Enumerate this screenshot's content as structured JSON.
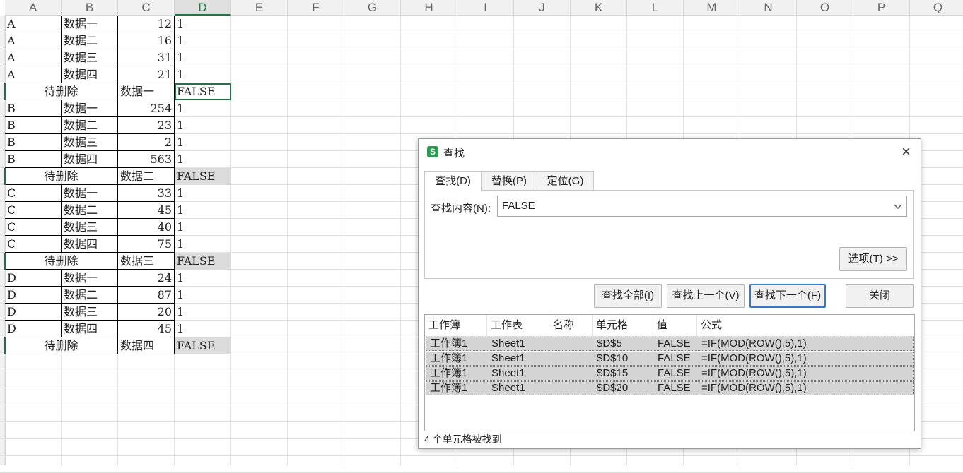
{
  "columns": [
    "A",
    "B",
    "C",
    "D",
    "E",
    "F",
    "G",
    "H",
    "I",
    "J",
    "K",
    "L",
    "M",
    "N",
    "O",
    "P",
    "Q"
  ],
  "rows": [
    {
      "a": "A",
      "b": "数据一",
      "c": "12",
      "d": "1"
    },
    {
      "a": "A",
      "b": "数据二",
      "c": "16",
      "d": "1"
    },
    {
      "a": "A",
      "b": "数据三",
      "c": "31",
      "d": "1"
    },
    {
      "a": "A",
      "b": "数据四",
      "c": "21",
      "d": "1"
    },
    {
      "merged": "待删除",
      "c": "数据一",
      "d": "FALSE"
    },
    {
      "a": "B",
      "b": "数据一",
      "c": "254",
      "d": "1"
    },
    {
      "a": "B",
      "b": "数据二",
      "c": "23",
      "d": "1"
    },
    {
      "a": "B",
      "b": "数据三",
      "c": "2",
      "d": "1"
    },
    {
      "a": "B",
      "b": "数据四",
      "c": "563",
      "d": "1"
    },
    {
      "merged": "待删除",
      "c": "数据二",
      "d": "FALSE"
    },
    {
      "a": "C",
      "b": "数据一",
      "c": "33",
      "d": "1"
    },
    {
      "a": "C",
      "b": "数据二",
      "c": "45",
      "d": "1"
    },
    {
      "a": "C",
      "b": "数据三",
      "c": "40",
      "d": "1"
    },
    {
      "a": "C",
      "b": "数据四",
      "c": "75",
      "d": "1"
    },
    {
      "merged": "待删除",
      "c": "数据三",
      "d": "FALSE"
    },
    {
      "a": "D",
      "b": "数据一",
      "c": "24",
      "d": "1"
    },
    {
      "a": "D",
      "b": "数据二",
      "c": "87",
      "d": "1"
    },
    {
      "a": "D",
      "b": "数据三",
      "c": "20",
      "d": "1"
    },
    {
      "a": "D",
      "b": "数据四",
      "c": "45",
      "d": "1"
    },
    {
      "merged": "待删除",
      "c": "数据四",
      "d": "FALSE"
    }
  ],
  "dialog": {
    "app_icon": "S",
    "title": "查找",
    "close_label": "×",
    "tabs": [
      "查找(D)",
      "替换(P)",
      "定位(G)"
    ],
    "find_label": "查找内容(N):",
    "find_value": "FALSE",
    "options_button": "选项(T) >>",
    "find_all_button": "查找全部(I)",
    "find_prev_button": "查找上一个(V)",
    "find_next_button": "查找下一个(F)",
    "close_button": "关闭",
    "result_headers": [
      "工作簿",
      "工作表",
      "名称",
      "单元格",
      "值",
      "公式"
    ],
    "results": [
      {
        "workbook": "工作簿1",
        "sheet": "Sheet1",
        "name": "",
        "cell": "$D$5",
        "value": "FALSE",
        "formula": "=IF(MOD(ROW(),5),1)"
      },
      {
        "workbook": "工作簿1",
        "sheet": "Sheet1",
        "name": "",
        "cell": "$D$10",
        "value": "FALSE",
        "formula": "=IF(MOD(ROW(),5),1)"
      },
      {
        "workbook": "工作簿1",
        "sheet": "Sheet1",
        "name": "",
        "cell": "$D$15",
        "value": "FALSE",
        "formula": "=IF(MOD(ROW(),5),1)"
      },
      {
        "workbook": "工作簿1",
        "sheet": "Sheet1",
        "name": "",
        "cell": "$D$20",
        "value": "FALSE",
        "formula": "=IF(MOD(ROW(),5),1)"
      }
    ],
    "status": "4 个单元格被找到"
  },
  "colors": {
    "selection_green": "#217346",
    "found_highlight": "#dcdcdc",
    "result_row": "#d4d4d4"
  }
}
